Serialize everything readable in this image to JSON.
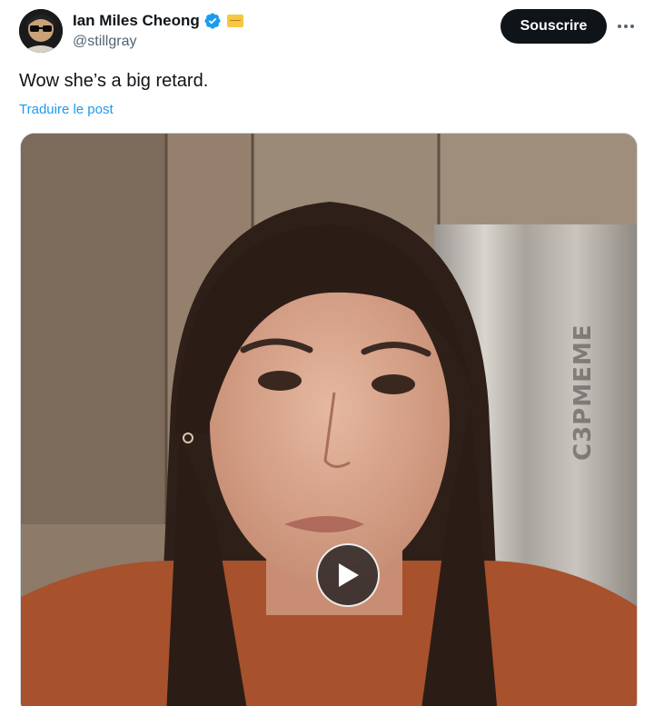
{
  "author": {
    "name": "Ian Miles Cheong",
    "handle": "@stillgray",
    "verified_color": "#1d9bf0"
  },
  "actions": {
    "subscribe_label": "Souscrire",
    "more_icon": "more-horizontal-icon"
  },
  "post": {
    "text": "Wow she’s a big retard.",
    "translate_label": "Traduire le post"
  },
  "media": {
    "type": "video",
    "watermark": "C3PMEME",
    "play_icon": "play-icon"
  },
  "colors": {
    "link": "#1d9bf0",
    "button_bg": "#0f1419",
    "text_secondary": "#536471"
  }
}
